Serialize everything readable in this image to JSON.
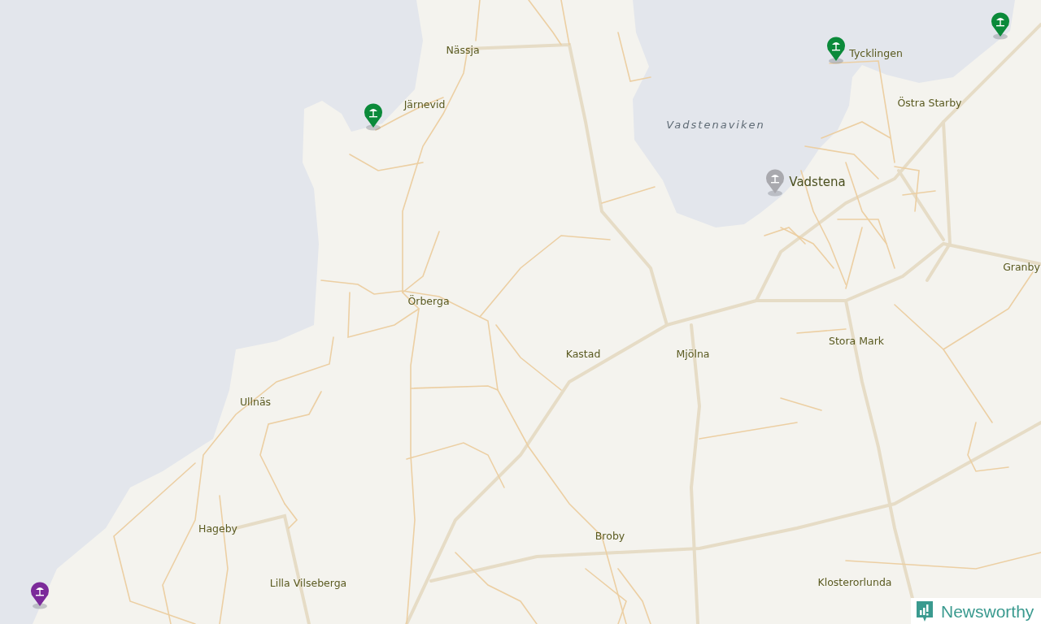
{
  "map": {
    "water_label": "Vadstenaviken",
    "places": [
      {
        "name": "Nässja",
        "kind": "village"
      },
      {
        "name": "Järnevid",
        "kind": "village"
      },
      {
        "name": "Tycklingen",
        "kind": "village"
      },
      {
        "name": "Östra Starby",
        "kind": "village"
      },
      {
        "name": "Vadstena",
        "kind": "town"
      },
      {
        "name": "Granby",
        "kind": "village"
      },
      {
        "name": "Örberga",
        "kind": "village"
      },
      {
        "name": "Kastad",
        "kind": "village"
      },
      {
        "name": "Mjölna",
        "kind": "village"
      },
      {
        "name": "Stora Mark",
        "kind": "village"
      },
      {
        "name": "Ullnäs",
        "kind": "village"
      },
      {
        "name": "Hageby",
        "kind": "village"
      },
      {
        "name": "Broby",
        "kind": "village"
      },
      {
        "name": "Lilla Vilseberga",
        "kind": "village"
      },
      {
        "name": "Klosterorlunda",
        "kind": "village"
      }
    ],
    "pins": [
      {
        "color": "#0b8a3a"
      },
      {
        "color": "#0b8a3a"
      },
      {
        "color": "#0b8a3a"
      },
      {
        "color": "#a9a9ae"
      },
      {
        "color": "#7b2a9a"
      }
    ]
  },
  "logo": {
    "text": "Newsworthy"
  }
}
